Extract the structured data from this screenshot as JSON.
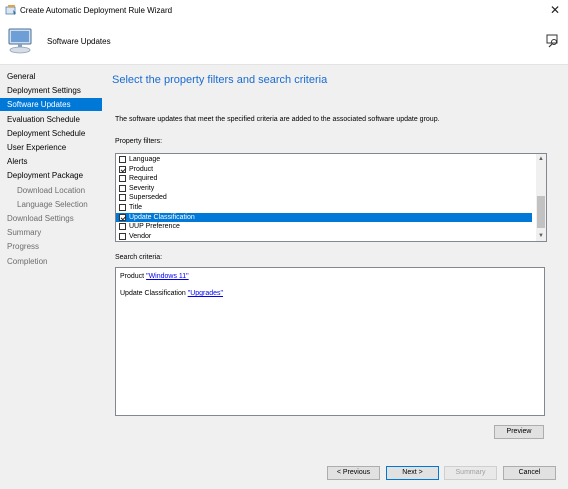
{
  "window": {
    "title": "Create Automatic Deployment Rule Wizard",
    "close_glyph": "✕"
  },
  "header": {
    "page_title": "Software Updates"
  },
  "nav": {
    "items": [
      {
        "label": "General",
        "state": "normal",
        "level": 0
      },
      {
        "label": "Deployment Settings",
        "state": "normal",
        "level": 0
      },
      {
        "label": "Software Updates",
        "state": "active",
        "level": 0
      },
      {
        "label": "Evaluation Schedule",
        "state": "normal",
        "level": 0
      },
      {
        "label": "Deployment Schedule",
        "state": "normal",
        "level": 0
      },
      {
        "label": "User Experience",
        "state": "normal",
        "level": 0
      },
      {
        "label": "Alerts",
        "state": "normal",
        "level": 0
      },
      {
        "label": "Deployment Package",
        "state": "normal",
        "level": 0
      },
      {
        "label": "Download Location",
        "state": "disabled",
        "level": 1
      },
      {
        "label": "Language Selection",
        "state": "disabled",
        "level": 1
      },
      {
        "label": "Download Settings",
        "state": "disabled",
        "level": 0
      },
      {
        "label": "Summary",
        "state": "disabled",
        "level": 0
      },
      {
        "label": "Progress",
        "state": "disabled",
        "level": 0
      },
      {
        "label": "Completion",
        "state": "disabled",
        "level": 0
      }
    ]
  },
  "main": {
    "heading": "Select the property filters and search criteria",
    "description": "The software updates that meet the specified criteria are added to the associated software update group.",
    "property_filters_label": "Property filters:",
    "property_filters": [
      {
        "label": "Language",
        "checked": false,
        "selected": false
      },
      {
        "label": "Product",
        "checked": true,
        "selected": false
      },
      {
        "label": "Required",
        "checked": false,
        "selected": false
      },
      {
        "label": "Severity",
        "checked": false,
        "selected": false
      },
      {
        "label": "Superseded",
        "checked": false,
        "selected": false
      },
      {
        "label": "Title",
        "checked": false,
        "selected": false
      },
      {
        "label": "Update Classification",
        "checked": true,
        "selected": true
      },
      {
        "label": "UUP Preference",
        "checked": false,
        "selected": false
      },
      {
        "label": "Vendor",
        "checked": false,
        "selected": false
      }
    ],
    "search_criteria_label": "Search criteria:",
    "criteria": [
      {
        "prefix": "Product ",
        "link": "\"Windows 11\""
      },
      {
        "prefix": "Update Classification ",
        "link": "\"Upgrades\""
      }
    ],
    "preview_label": "Preview"
  },
  "footer": {
    "previous_label": "< Previous",
    "next_label": "Next >",
    "summary_label": "Summary",
    "cancel_label": "Cancel"
  },
  "colors": {
    "accent": "#0078d7",
    "heading": "#1a6ccf",
    "link": "#0000ee",
    "panel": "#f0f0f0"
  }
}
